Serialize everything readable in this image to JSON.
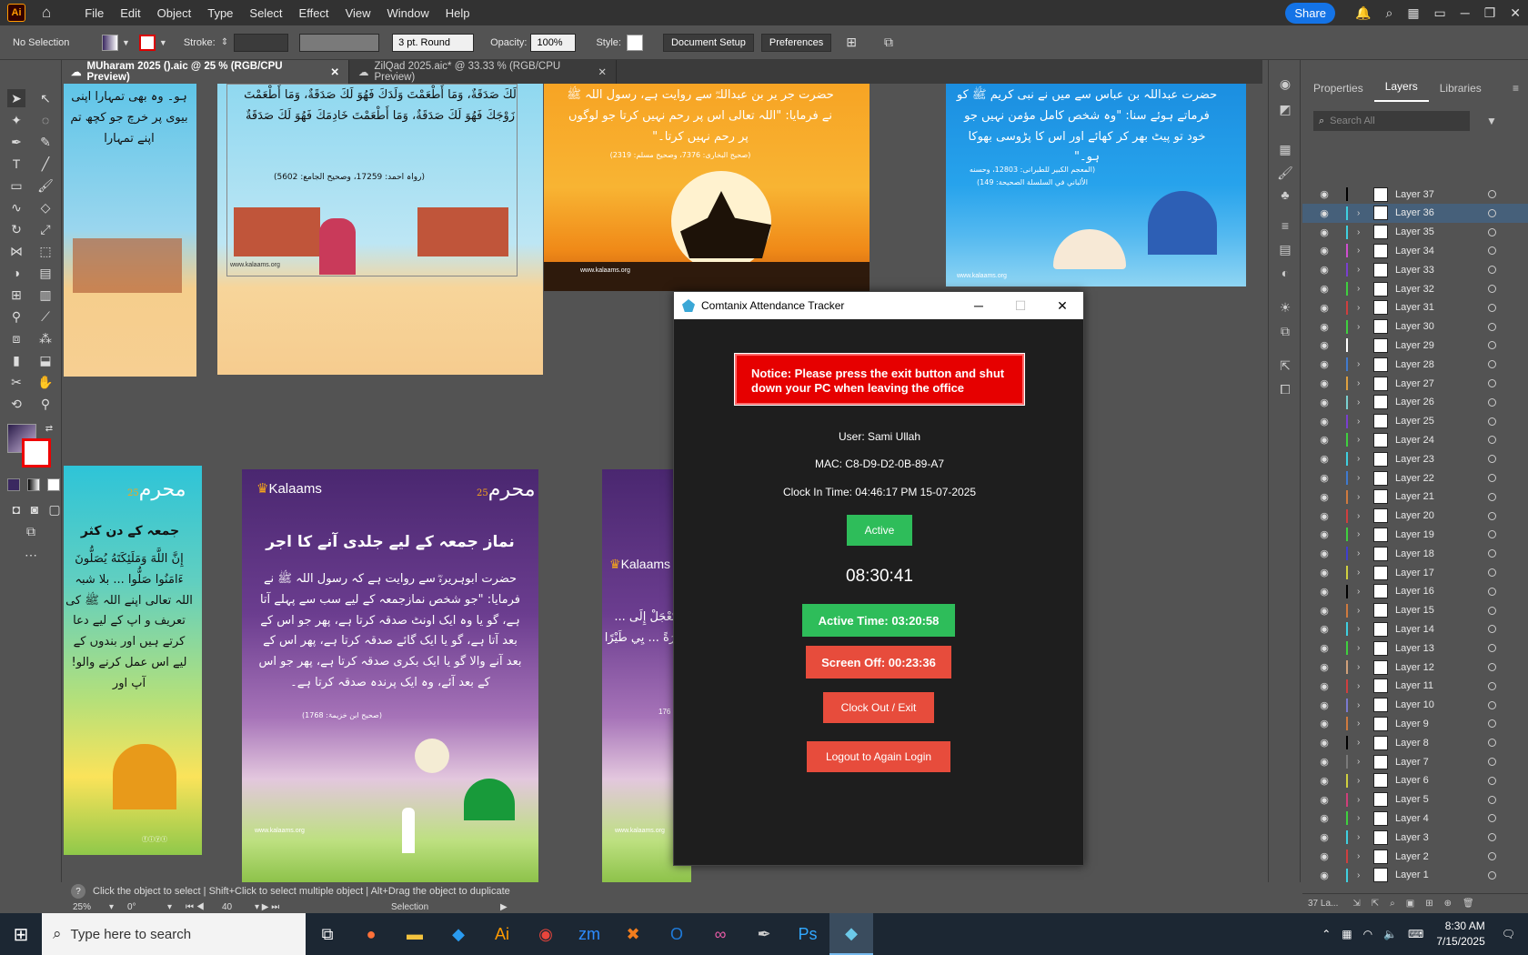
{
  "menubar": {
    "logo": "Ai",
    "items": [
      "File",
      "Edit",
      "Object",
      "Type",
      "Select",
      "Effect",
      "View",
      "Window",
      "Help"
    ],
    "share": "Share"
  },
  "controlbar": {
    "selection": "No Selection",
    "stroke_label": "Stroke:",
    "brush": "3 pt. Round",
    "opacity_label": "Opacity:",
    "opacity": "100%",
    "style_label": "Style:",
    "doc_setup": "Document Setup",
    "preferences": "Preferences"
  },
  "tabs": [
    {
      "label": "MUharam 2025 ().aic @ 25 % (RGB/CPU Preview)",
      "active": true
    },
    {
      "label": "ZilQad 2025.aic* @ 33.33 % (RGB/CPU Preview)",
      "active": false
    }
  ],
  "artboards": {
    "a1_text": "ہو۔ وہ بھی تمہارا اپنی بیوی پر خرچ جو کچھ تم اپنے تمہارا",
    "a2_text": "لَكَ صَدَقَةٌ، وَمَا أَطْعَمْتَ وَلَدَكَ فَهُوَ لَكَ صَدَقَةٌ، وَمَا أَطْعَمْتَ زَوْجَكَ فَهُوَ لَكَ صَدَقَةٌ، وَمَا أَطْعَمْتَ خَادِمَكَ فَهُوَ لَكَ صَدَقَةٌ",
    "a2_ref": "(رواہ احمد: 17259، وصحیح الجامع: 5602)",
    "a3_text": "حضرت جر یر بن عبداللہؓ سے روایت ہے، رسول اللہ ﷺ نے فرمایا: \"اللہ تعالی اس پر رحم نہیں کرتا جو لوگوں پر رحم نہیں کرتا۔\"",
    "a3_ref": "(صحیح البخاری: 7376، وصحیح مسلم: 2319)",
    "a4_text": "حضرت عبداللہ بن عباس سے میں نے نبی کریم ﷺ کو فرماتے ہوئے سنا: \"وہ شخص کامل مؤمن نہیں جو خود تو پیٹ بھر کر کھائے اور اس کا پڑوسی بھوکا ہو۔\"",
    "a4_ref": "(المعجم الکبیر للطبرانی: 12803، وحسنه الألباني في السلسلة الصحيحة: 149)",
    "website": "www.kalaams.org",
    "a5_title": "جمعہ کے دن کثر",
    "a5_text": "إِنَّ اللَّهَ وَمَلَئِكَتَهُ يُصَلُّونَ ءَامَنُوا صَلُّوا ... بلا شبہ اللہ تعالی اپنے اللہ ﷺ کی تعریف و اپ کے لیے دعا کرتے ہیں اور بندوں کے لیے اس عمل کرنے والو! آپ اور",
    "brand": "Kalaams",
    "muharram_num": "25",
    "a6_title": "نماز جمعہ کے لیے جلدی آنے کا اجر",
    "a6_text": "حضرت ابوہریرہؓ سے روایت ہے کہ رسول اللہ ﷺ نے فرمایا: \"جو شخص نمازجمعہ کے لیے سب سے پہلے آتا ہے، گو یا وہ ایک اونٹ صدقہ کرتا ہے، پھر جو اس کے بعد آتا ہے، گو یا ایک گائے صدقہ کرتا ہے، پھر اس کے بعد آنے والا گو یا ایک بکری صدقہ کرتا ہے، پھر جو اس کے بعد آئے، وہ ایک پرندہ صدقہ کرتا ہے۔",
    "a6_ref": "(صحیح ابن خزیمۃ: 1768)",
    "a7_text": "تَعْجَلْ إِلَى ... بَقَرَةً ... يِي طَيْرًا",
    "a7_num": "176"
  },
  "layers_panel": {
    "tabs": [
      "Properties",
      "Layers",
      "Libraries"
    ],
    "search_placeholder": "Search All",
    "layers": [
      "Layer 37",
      "Layer 36",
      "Layer 35",
      "Layer 34",
      "Layer 33",
      "Layer 32",
      "Layer 31",
      "Layer 30",
      "Layer 29",
      "Layer 28",
      "Layer 27",
      "Layer 26",
      "Layer 25",
      "Layer 24",
      "Layer 23",
      "Layer 22",
      "Layer 21",
      "Layer 20",
      "Layer 19",
      "Layer 18",
      "Layer 17",
      "Layer 16",
      "Layer 15",
      "Layer 14",
      "Layer 13",
      "Layer 12",
      "Layer 11",
      "Layer 10",
      "Layer 9",
      "Layer 8",
      "Layer 7",
      "Layer 6",
      "Layer 5",
      "Layer 4",
      "Layer 3",
      "Layer 2",
      "Layer 1"
    ],
    "layer_colors": [
      "#000000",
      "#3fd0e0",
      "#3fd0e0",
      "#d04fd0",
      "#7a3fd0",
      "#3fd03f",
      "#d03f3f",
      "#3fd03f",
      "#ffffff",
      "#3f7ad0",
      "#e0a03f",
      "#7ad0d0",
      "#7a3fd0",
      "#3fd03f",
      "#3fd0e0",
      "#3f7ad0",
      "#d07a3f",
      "#d03f3f",
      "#3fd03f",
      "#3f3fd0",
      "#d0d03f",
      "#000000",
      "#d07a3f",
      "#3fd0e0",
      "#3fd03f",
      "#d0a07a",
      "#d03f3f",
      "#7a7ad0",
      "#d07a3f",
      "#000000",
      "#7a7a7a",
      "#d0d03f",
      "#d03f7a",
      "#3fd03f",
      "#3fd0e0",
      "#d03f3f",
      "#3fd0e0"
    ],
    "selected": "Layer 36",
    "footer_count": "37 La..."
  },
  "status": {
    "hint": "Click the object to select  |  Shift+Click to select multiple object  |  Alt+Drag the object to duplicate",
    "zoom": "25%",
    "angle": "0°",
    "artboard_num": "40",
    "tool": "Selection"
  },
  "attendance_window": {
    "title": "Comtanix Attendance Tracker",
    "notice": "Notice: Please press the exit button and shut down your PC when leaving the office",
    "user": "User: Sami Ullah",
    "mac": "MAC: C8-D9-D2-0B-89-A7",
    "clock_in": "Clock In Time: 04:46:17 PM 15-07-2025",
    "status": "Active",
    "timer": "08:30:41",
    "active_time": "Active Time: 03:20:58",
    "screen_off": "Screen Off: 00:23:36",
    "clock_out": "Clock Out / Exit",
    "logout": "Logout to Again Login"
  },
  "taskbar": {
    "search_placeholder": "Type here to search",
    "time": "8:30 AM",
    "date": "7/15/2025"
  }
}
